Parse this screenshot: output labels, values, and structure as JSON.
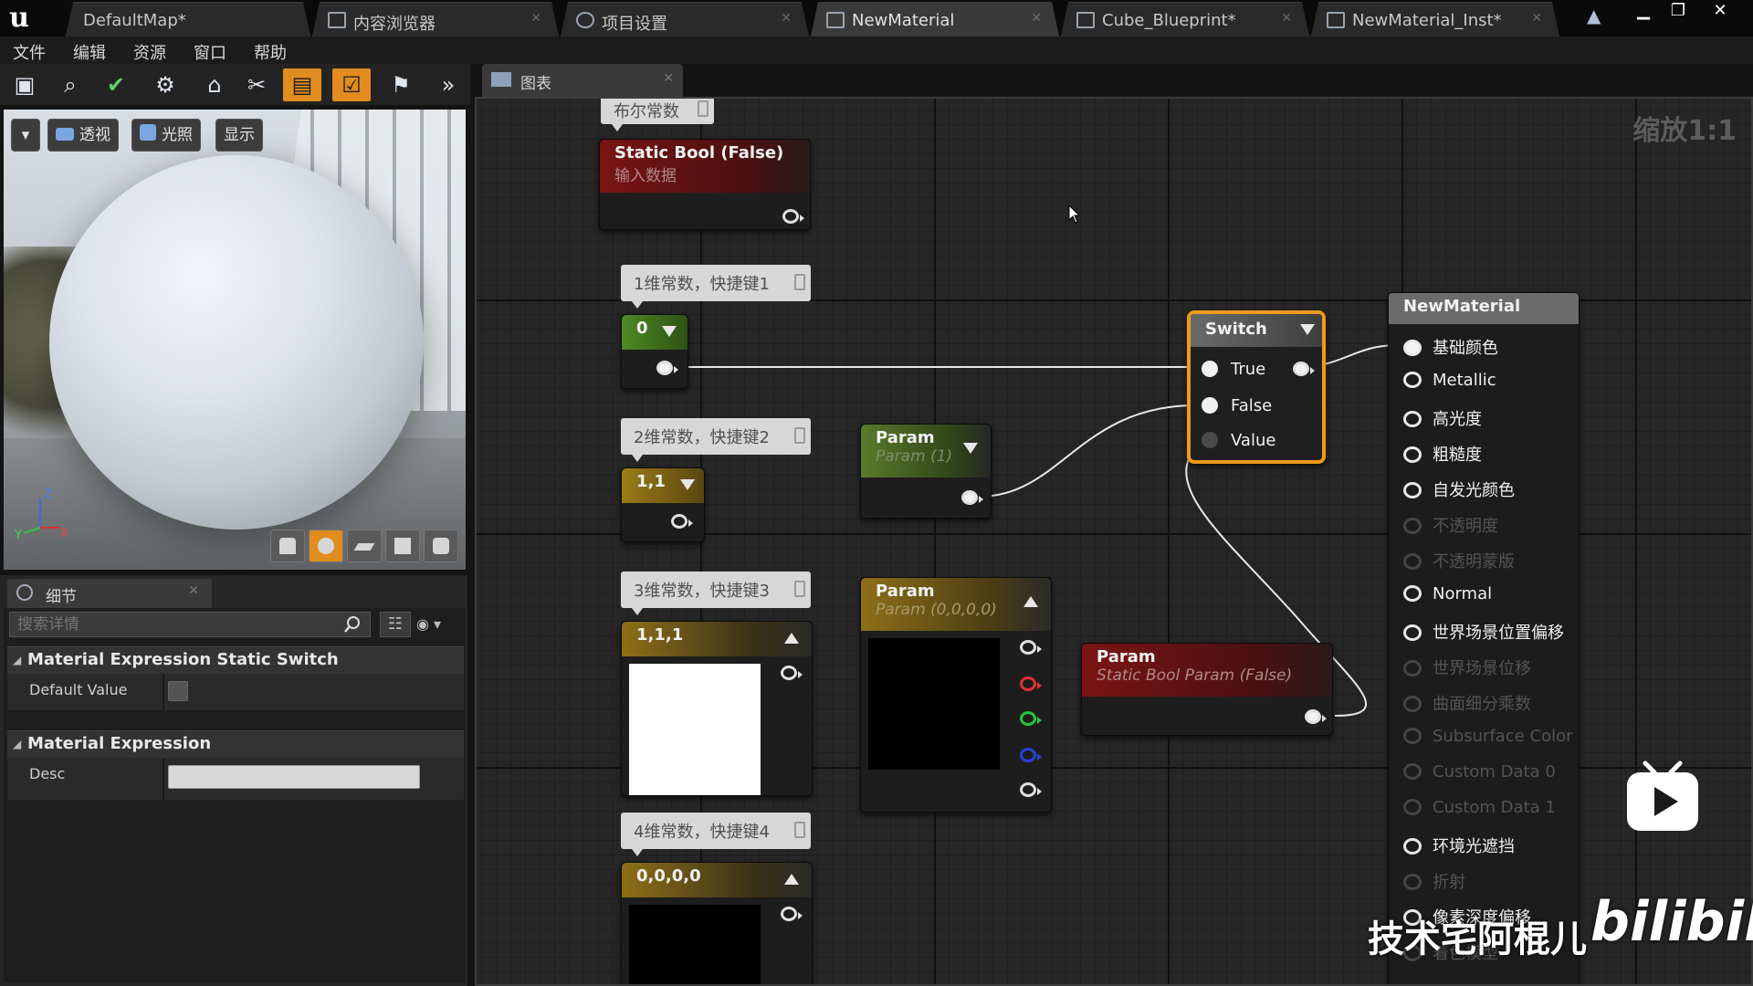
{
  "tabs": [
    {
      "label": "DefaultMap*",
      "active": false
    },
    {
      "label": "内容浏览器",
      "active": false
    },
    {
      "label": "项目设置",
      "active": false
    },
    {
      "label": "NewMaterial",
      "active": true
    },
    {
      "label": "Cube_Blueprint*",
      "active": false
    },
    {
      "label": "NewMaterial_Inst*",
      "active": false
    }
  ],
  "menu": [
    "文件",
    "编辑",
    "资源",
    "窗口",
    "帮助"
  ],
  "toolbar_icons": [
    "save-icon",
    "browse-icon",
    "apply-icon",
    "node-search-icon",
    "home-icon",
    "clean-up-icon",
    "connectors-icon",
    "live-preview-icon",
    "live-update-icon",
    "stats-icon",
    "more-icon"
  ],
  "viewport": {
    "buttons": [
      "透视",
      "光照",
      "显示"
    ],
    "axis": {
      "z": "Z",
      "y": "Y",
      "x": "X"
    },
    "preview_shapes": [
      "cylinder-icon",
      "sphere-icon",
      "plane-icon",
      "cube-icon",
      "custom-mesh-icon"
    ],
    "active_shape": "sphere-icon"
  },
  "details": {
    "tab_label": "细节",
    "search_placeholder": "搜索详情",
    "categories": [
      {
        "title": "Material Expression Static Switch",
        "props": [
          {
            "name": "Default Value",
            "checked": false
          }
        ]
      },
      {
        "title": "Material Expression",
        "props": [
          {
            "name": "Desc",
            "value": ""
          }
        ]
      }
    ]
  },
  "graph": {
    "tab_label": "图表",
    "zoom": "缩放1:1",
    "palette_comments": {
      "bool": "布尔常数",
      "c1": "1维常数，快捷键1",
      "c2": "2维常数，快捷键2",
      "c3": "3维常数，快捷键3",
      "c4": "4维常数，快捷键4"
    },
    "nodes": {
      "static_bool": {
        "title": "Static Bool (False)",
        "subtitle": "输入数据"
      },
      "const1": {
        "value": "0"
      },
      "const2": {
        "value": "1,1"
      },
      "const3": {
        "value": "1,1,1",
        "swatch": "#ffffff"
      },
      "const4": {
        "value": "0,0,0,0",
        "swatch": "#000000"
      },
      "param_scalar": {
        "title": "Param",
        "subtitle": "Param (1)"
      },
      "param_vector": {
        "title": "Param",
        "subtitle": "Param (0,0,0,0)",
        "swatch": "#000000"
      },
      "static_bool_param": {
        "title": "Param",
        "subtitle": "Static Bool Param (False)"
      },
      "switch": {
        "title": "Switch",
        "inputs": [
          "True",
          "False",
          "Value"
        ]
      },
      "result": {
        "title": "NewMaterial",
        "inputs": [
          {
            "label": "基础颜色",
            "enabled": true,
            "connected": true
          },
          {
            "label": "Metallic",
            "enabled": true,
            "connected": false
          },
          {
            "label": "高光度",
            "enabled": true,
            "connected": false
          },
          {
            "label": "粗糙度",
            "enabled": true,
            "connected": false
          },
          {
            "label": "自发光颜色",
            "enabled": true,
            "connected": false
          },
          {
            "label": "不透明度",
            "enabled": false,
            "connected": false
          },
          {
            "label": "不透明蒙版",
            "enabled": false,
            "connected": false
          },
          {
            "label": "Normal",
            "enabled": true,
            "connected": false
          },
          {
            "label": "世界场景位置偏移",
            "enabled": true,
            "connected": false
          },
          {
            "label": "世界场景位移",
            "enabled": false,
            "connected": false
          },
          {
            "label": "曲面细分乘数",
            "enabled": false,
            "connected": false
          },
          {
            "label": "Subsurface Color",
            "enabled": false,
            "connected": false
          },
          {
            "label": "Custom Data 0",
            "enabled": false,
            "connected": false
          },
          {
            "label": "Custom Data 1",
            "enabled": false,
            "connected": false
          },
          {
            "label": "环境光遮挡",
            "enabled": true,
            "connected": false
          },
          {
            "label": "折射",
            "enabled": false,
            "connected": false
          },
          {
            "label": "像素深度偏移",
            "enabled": true,
            "connected": false
          },
          {
            "label": "着色模型",
            "enabled": false,
            "connected": false
          }
        ]
      }
    }
  },
  "colors": {
    "accent_orange": "#e08c1e",
    "switch_border": "#f19a1a",
    "const1_header": "#4f8a24",
    "const2_header": "#9a7c18",
    "vector_header": "#8e6f18",
    "bool_header": "#7a1414",
    "param_header": "#5a7a2a",
    "result_header": "#6b6b6b"
  },
  "watermark": {
    "text": "技术宅阿棍儿",
    "brand": "bilibili"
  }
}
